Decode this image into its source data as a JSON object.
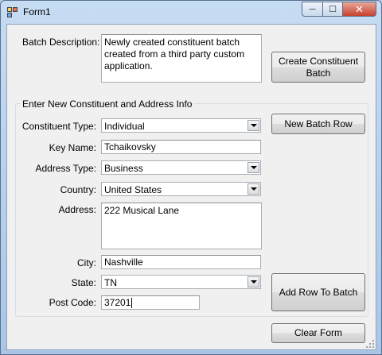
{
  "window": {
    "title": "Form1",
    "buttons": {
      "minimize": "─",
      "maximize": "☐",
      "close": "✕"
    }
  },
  "batch": {
    "description_label": "Batch Description:",
    "description_value": "Newly created constituent batch created from a third party custom application.",
    "create_button": "Create Constituent Batch"
  },
  "group": {
    "title": "Enter New Constituent and Address Info",
    "constituent_type_label": "Constituent Type:",
    "constituent_type_value": "Individual",
    "key_name_label": "Key Name:",
    "key_name_value": "Tchaikovsky",
    "address_type_label": "Address Type:",
    "address_type_value": "Business",
    "country_label": "Country:",
    "country_value": "United States",
    "address_label": "Address:",
    "address_value": "222 Musical Lane",
    "city_label": "City:",
    "city_value": "Nashville",
    "state_label": "State:",
    "state_value": "TN",
    "post_code_label": "Post Code:",
    "post_code_value": "37201",
    "new_batch_row_button": "New Batch Row",
    "add_row_button": "Add Row To Batch"
  },
  "footer": {
    "clear_form_button": "Clear Form"
  }
}
